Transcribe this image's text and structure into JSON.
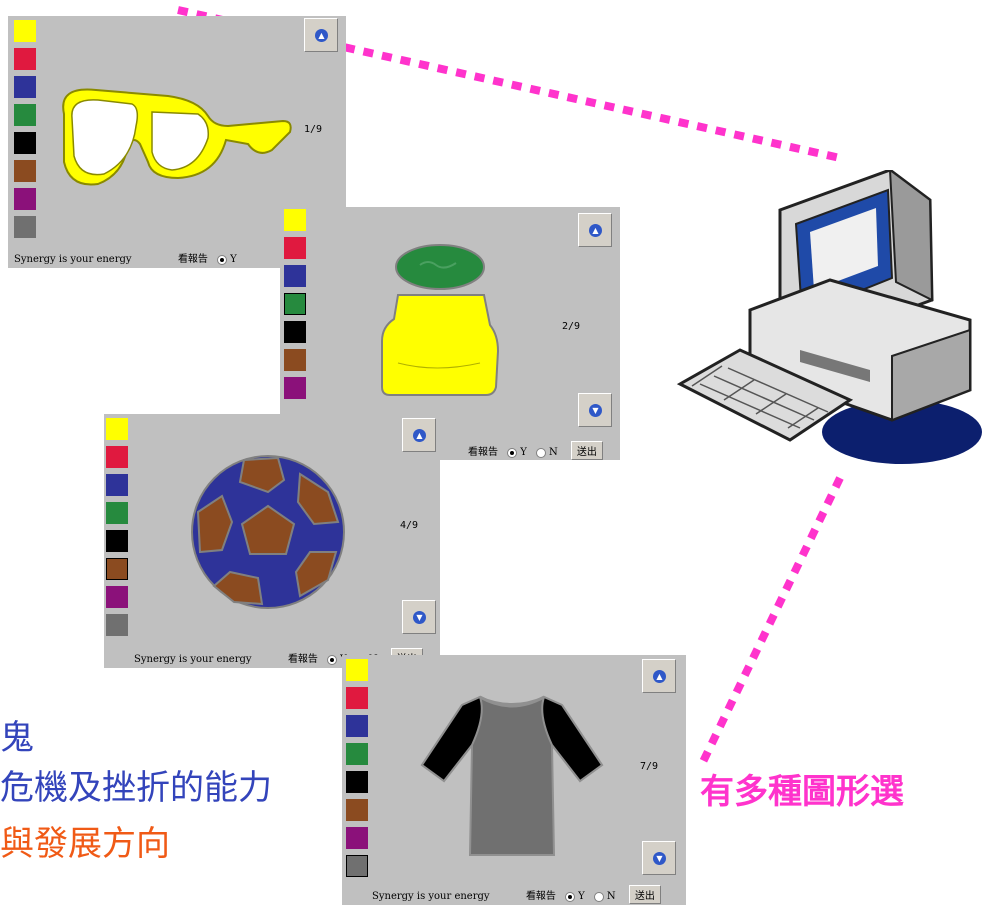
{
  "colors": {
    "palette": [
      "#ffff00",
      "#e0193f",
      "#2e3399",
      "#268a3e",
      "#000000",
      "#8b4b20",
      "#8b117a",
      "#707070"
    ],
    "window_bg": "#c0c0c0",
    "dotted_connector": "#ff33cc",
    "left_text_blue": "#3344bb",
    "left_text_orange": "#f05a16",
    "callout": "#ff33cc"
  },
  "windows": [
    {
      "page": "1/9",
      "footer_text": "Synergy is your energy",
      "report_label": "看報告",
      "yes_label": "Y",
      "picture": "glasses"
    },
    {
      "page": "2/9",
      "report_label": "看報告",
      "yes_label": "Y",
      "no_label": "N",
      "send_label": "送出",
      "picture": "bottle"
    },
    {
      "page": "4/9",
      "footer_text": "Synergy is your energy",
      "report_label": "看報告",
      "yes_label": "Y",
      "no_label": "N",
      "send_label": "送出",
      "picture": "soccer-ball"
    },
    {
      "page": "7/9",
      "footer_text": "Synergy is your energy",
      "report_label": "看報告",
      "yes_label": "Y",
      "no_label": "N",
      "send_label": "送出",
      "picture": "t-shirt"
    }
  ],
  "left_text": {
    "line1": "鬼",
    "line2": "危機及挫折的能力",
    "line3": "與發展方向"
  },
  "callout_text": "有多種圖形選",
  "icons": {
    "up": "chevron-up-icon",
    "down": "chevron-down-icon",
    "computer": "desktop-computer-icon"
  }
}
